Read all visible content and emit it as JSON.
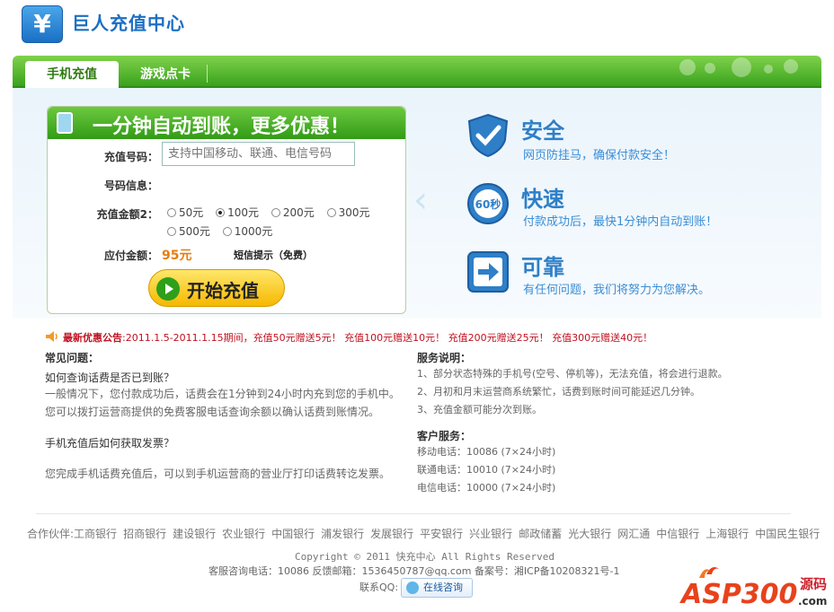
{
  "header": {
    "logo_symbol": "¥",
    "title": "巨人充值中心"
  },
  "nav": {
    "tabs": [
      "手机充值",
      "游戏点卡"
    ],
    "active": 0
  },
  "recharge": {
    "banner": "一分钟自动到账，更多优惠！",
    "phone_label": "充值号码：",
    "phone_placeholder": "支持中国移动、联通、电信号码",
    "info_label": "号码信息：",
    "amount_label": "充值金额2：",
    "amounts": [
      "50元",
      "100元",
      "200元",
      "300元",
      "500元",
      "1000元"
    ],
    "selected_amount": "100元",
    "pay_label": "应付金额：",
    "pay_amount": "95元",
    "sms": "短信提示（免费）",
    "start_button": "开始充值"
  },
  "features": [
    {
      "icon": "shield-check-icon",
      "title": "安全",
      "desc": "网页防挂马，确保付款安全！"
    },
    {
      "icon": "clock-60s-icon",
      "title": "快速",
      "desc": "付款成功后，最快1分钟内自动到账！"
    },
    {
      "icon": "arrow-right-icon",
      "title": "可靠",
      "desc": "有任何问题，我们将努力为您解决。"
    }
  ],
  "notice": {
    "head": "最新优惠公告",
    "text": ":2011.1.5-2011.1.15期间，充值50元赠送5元！ 充值100元赠送10元！ 充值200元赠送25元！ 充值300元赠送40元！"
  },
  "faq": {
    "title": "常见问题：",
    "q1": "如何查询话费是否已到账？",
    "a1_line1": "一般情况下，您付款成功后，话费会在1分钟到24小时内充到您的手机中。",
    "a1_line2": "您可以拨打运营商提供的免费客服电话查询余额以确认话费到账情况。",
    "q2": "手机充值后如何获取发票？",
    "a2": "您完成手机话费充值后，可以到手机运营商的营业厅打印话费转讫发票。"
  },
  "service": {
    "title": "服务说明：",
    "items": [
      "1、部分状态特殊的手机号(空号、停机等)，无法充值，将会进行退款。",
      "2、月初和月末运营商系统繁忙，话费到账时间可能延迟几分钟。",
      "3、充值金额可能分次到账。"
    ],
    "cs_title": "客户服务：",
    "cs_items": [
      "移动电话：10086  (7×24小时)",
      "联通电话：10010  (7×24小时)",
      "电信电话：10000  (7×24小时)"
    ]
  },
  "footer": {
    "partners_label": "合作伙伴:",
    "partners": [
      "工商银行",
      "招商银行",
      "建设银行",
      "农业银行",
      "中国银行",
      "浦发银行",
      "发展银行",
      "平安银行",
      "兴业银行",
      "邮政储蓄",
      "光大银行",
      "网汇通",
      "中信银行",
      "上海银行",
      "中国民生银行"
    ],
    "copyright": "Copyright © 2011 快充中心 All Rights Reserved",
    "contact": "客服咨询电话：10086   反馈邮箱：1536450787@qq.com     备案号：湘ICP备10208321号-1",
    "qq_label": "联系QQ:",
    "consult": "在线咨询"
  },
  "watermark": {
    "text": "ASP300",
    "suffix": "源码",
    "domain": ".com"
  },
  "colors": {
    "green": "#3aa21d",
    "blue": "#2e7fc8",
    "orange": "#e87c0e",
    "red": "#c0101f"
  }
}
